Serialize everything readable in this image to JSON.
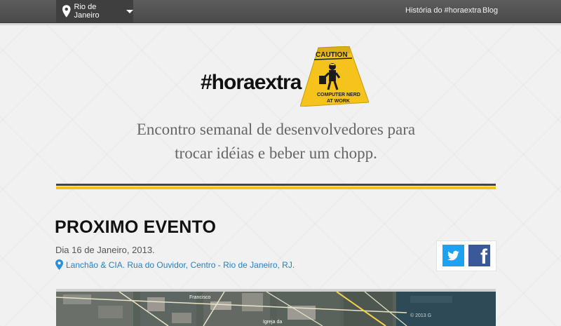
{
  "topbar": {
    "city_label": "Rio de Janeiro",
    "nav_history": "História do #horaextra",
    "nav_blog": "Blog"
  },
  "logo": {
    "text": "#horaextra",
    "sign_caution": "CAUTION",
    "sign_line1": "COMPUTER NERD",
    "sign_line2": "AT WORK"
  },
  "tagline": {
    "line1": "Encontro semanal de desenvolvedores para",
    "line2": "trocar idéias e beber um chopp."
  },
  "event": {
    "title": "PROXIMO EVENTO",
    "date": "Dia 16 de Janeiro, 2013.",
    "location": "Lanchão & CIA. Rua do Ouvidor, Centro - Rio de Janeiro, RJ."
  },
  "share": {
    "twitter_icon": "twitter-icon",
    "facebook_icon": "facebook-icon"
  },
  "map": {
    "label_igreja": "Igreja da",
    "label_francisco": "Francisco",
    "copyright": "© 2013 G"
  },
  "colors": {
    "accent_yellow": "#f3c21b",
    "link_blue": "#2a7fc0",
    "topbar": "#4f4f4f"
  }
}
